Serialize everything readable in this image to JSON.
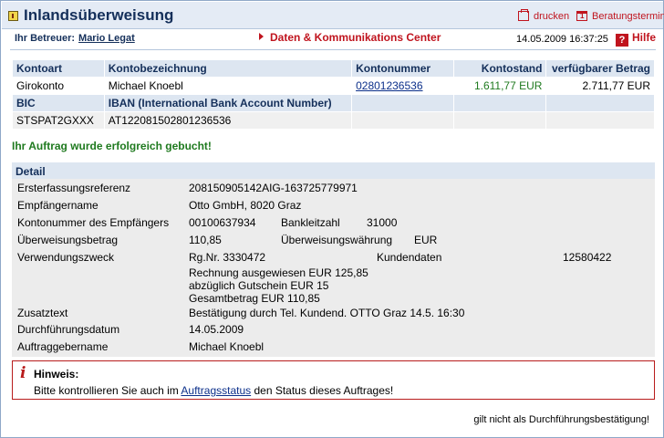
{
  "titlebar": {
    "title": "Inlandsüberweisung",
    "print_label": "drucken",
    "appointment_label": "Beratungstermin",
    "title_icon": "transfer-icon",
    "print_icon": "printer-icon",
    "appointment_icon": "calendar-icon"
  },
  "advisor": {
    "label": "Ihr Betreuer:",
    "name": "Mario Legat"
  },
  "datacenter": {
    "label": "Daten & Kommunikations Center"
  },
  "datetime": "14.05.2009 16:37:25",
  "help": {
    "label": "Hilfe",
    "icon_text": "?"
  },
  "account": {
    "headers": [
      "Kontoart",
      "Kontobezeichnung",
      "Kontonummer",
      "Kontostand",
      "verfügbarer Betrag"
    ],
    "row": {
      "type": "Girokonto",
      "holder": "Michael Knoebl",
      "number": "02801236536",
      "balance": "1.611,77 EUR",
      "available": "2.711,77 EUR"
    },
    "headers2": [
      "BIC",
      "IBAN (International Bank Account Number)"
    ],
    "bic": "STSPAT2GXXX",
    "iban": "AT122081502801236536"
  },
  "success_message": "Ihr Auftrag wurde erfolgreich gebucht!",
  "detail": {
    "header": "Detail",
    "ref_label": "Ersterfassungsreferenz",
    "ref_value": "208150905142AIG-163725779971",
    "recipient_label": "Empfängername",
    "recipient_value": "Otto GmbH, 8020 Graz",
    "recipient_acct_label": "Kontonummer des Empfängers",
    "recipient_acct_value": "00100637934",
    "blz_label": "Bankleitzahl",
    "blz_value": "31000",
    "amount_label": "Überweisungsbetrag",
    "amount_value": "110,85",
    "currency_label": "Überweisungswährung",
    "currency_value": "EUR",
    "purpose_label": "Verwendungszweck",
    "purpose_value": "Rg.Nr. 3330472",
    "customer_label": "Kundendaten",
    "customer_value": "12580422",
    "purpose_lines": [
      "Rechnung ausgewiesen EUR 125,85",
      "abzüglich Gutschein EUR 15",
      "Gesamtbetrag EUR 110,85"
    ],
    "extra_label": "Zusatztext",
    "extra_value": "Bestätigung durch Tel. Kundend. OTTO Graz 14.5. 16:30",
    "exec_date_label": "Durchführungsdatum",
    "exec_date_value": "14.05.2009",
    "client_label": "Auftraggebername",
    "client_value": "Michael Knoebl"
  },
  "hint": {
    "icon_glyph": "i",
    "title": "Hinweis:",
    "text_before": "Bitte kontrollieren Sie auch im ",
    "link": "Auftragsstatus",
    "text_after": " den Status dieses Auftrages!"
  },
  "footer_note": "gilt nicht als Durchführungsbestätigung!",
  "colors": {
    "title": "#142f5a",
    "accent_red": "#c0141e",
    "success_green": "#1f7a1f",
    "header_bg": "#dde6f1",
    "detail_bg": "#ececec"
  }
}
